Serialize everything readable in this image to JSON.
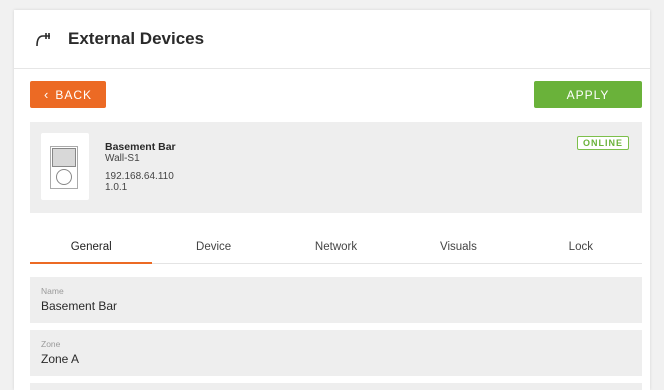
{
  "header": {
    "title": "External Devices",
    "icon": "external-device-icon"
  },
  "actions": {
    "back_label": "BACK",
    "apply_label": "APPLY"
  },
  "device": {
    "name": "Basement Bar",
    "model": "Wall-S1",
    "ip": "192.168.64.110",
    "version": "1.0.1",
    "status": "ONLINE"
  },
  "tabs": [
    {
      "label": "General"
    },
    {
      "label": "Device"
    },
    {
      "label": "Network"
    },
    {
      "label": "Visuals"
    },
    {
      "label": "Lock"
    }
  ],
  "fields": {
    "name": {
      "label": "Name",
      "value": "Basement Bar"
    },
    "zone": {
      "label": "Zone",
      "value": "Zone A"
    }
  },
  "colors": {
    "accent_orange": "#ec6a24",
    "apply_green": "#6ab23a",
    "status_green": "#7cbf4a",
    "panel_gray": "#eeeeee"
  }
}
